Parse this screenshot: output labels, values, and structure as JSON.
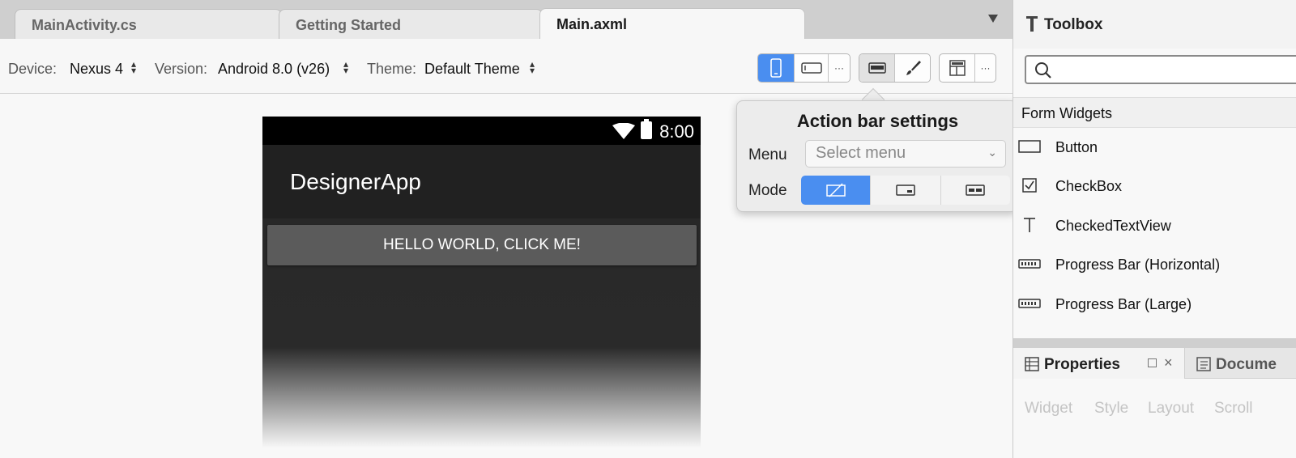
{
  "tabs": [
    {
      "label": "MainActivity.cs"
    },
    {
      "label": "Getting Started"
    },
    {
      "label": "Main.axml"
    }
  ],
  "tab_close": "×",
  "toolbar": {
    "device_label": "Device:",
    "device_value": "Nexus 4",
    "version_label": "Version:",
    "version_value": "Android 8.0 (v26)",
    "theme_label": "Theme:",
    "theme_value": "Default Theme",
    "more": "···",
    "accent": "#4a8ef0"
  },
  "phone": {
    "time": "8:00",
    "app_title": "DesignerApp",
    "button_label": "HELLO WORLD, CLICK ME!"
  },
  "popover": {
    "title": "Action bar settings",
    "menu_label": "Menu",
    "menu_placeholder": "Select menu",
    "mode_label": "Mode"
  },
  "toolbox": {
    "title": "Toolbox",
    "category": "Form Widgets",
    "items": [
      {
        "label": "Button",
        "icon": "button-icon"
      },
      {
        "label": "CheckBox",
        "icon": "checkbox-icon"
      },
      {
        "label": "CheckedTextView",
        "icon": "text-icon"
      },
      {
        "label": "Progress Bar (Horizontal)",
        "icon": "progress-bar-icon"
      },
      {
        "label": "Progress Bar (Large)",
        "icon": "progress-bar-icon"
      }
    ]
  },
  "properties": {
    "title": "Properties",
    "close": "×",
    "doc_tab": "Docume",
    "tabs": [
      "Widget",
      "Style",
      "Layout",
      "Scroll"
    ]
  }
}
